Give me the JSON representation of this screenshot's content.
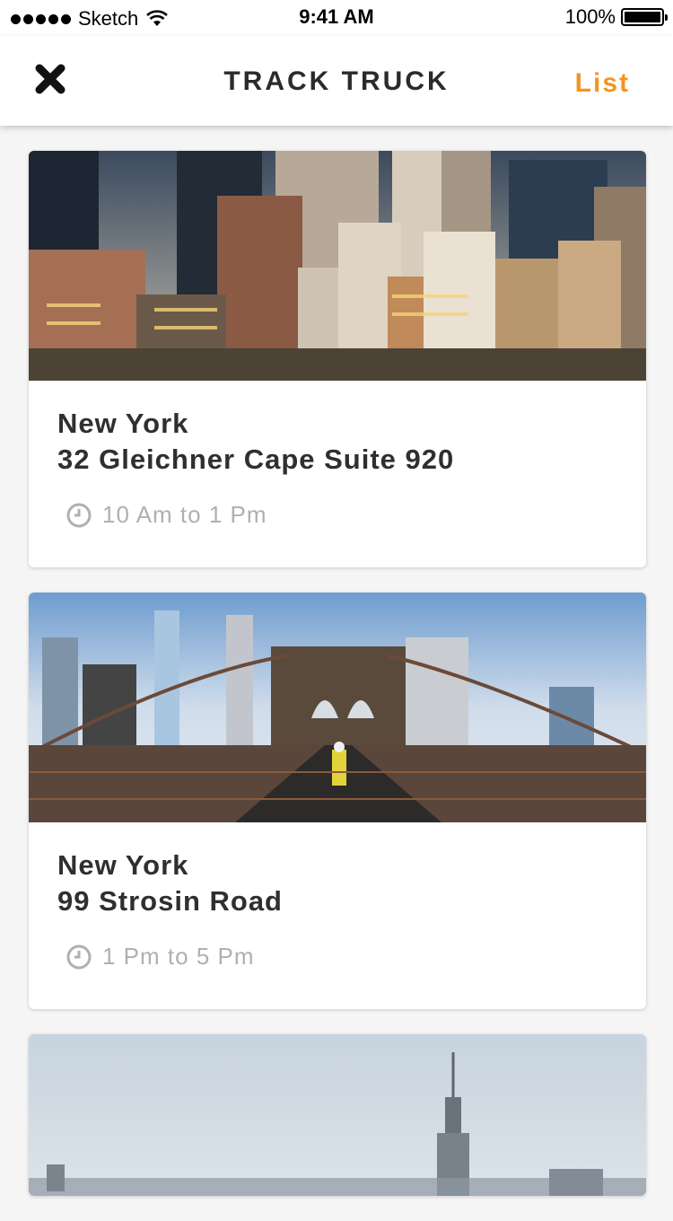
{
  "status_bar": {
    "carrier": "Sketch",
    "time": "9:41 AM",
    "battery": "100%"
  },
  "nav": {
    "title": "TRACK TRUCK",
    "action": "List",
    "accent": "#f5941f"
  },
  "cards": [
    {
      "city": "New York",
      "address": "32 Gleichner Cape Suite 920",
      "hours": "10 Am to 1 Pm",
      "image": "city-skyline-photo"
    },
    {
      "city": "New York",
      "address": "99 Strosin Road",
      "hours": "1 Pm to 5 Pm",
      "image": "brooklyn-bridge-photo"
    },
    {
      "image": "empire-state-skyline-photo"
    }
  ]
}
